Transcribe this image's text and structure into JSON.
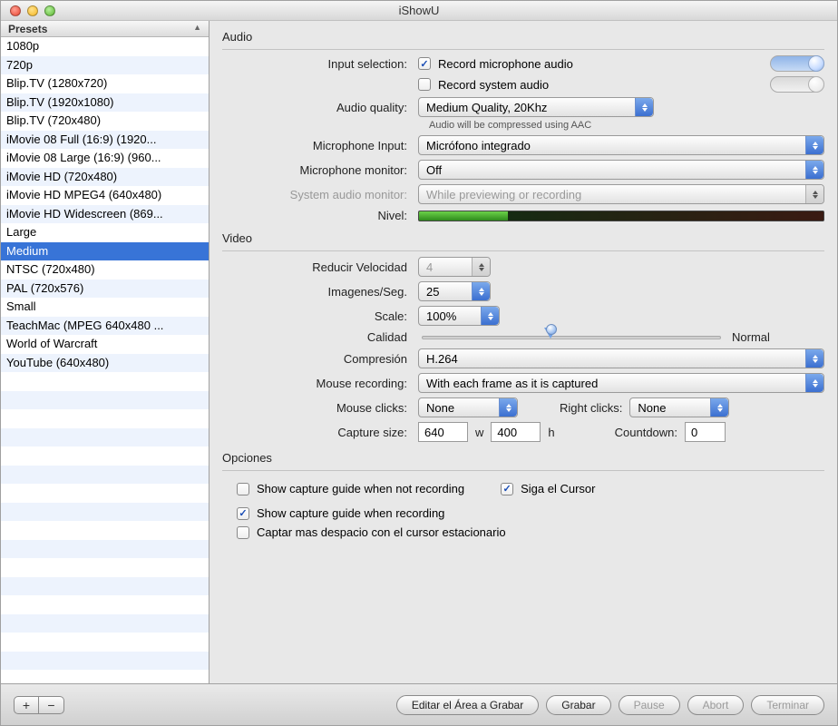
{
  "window": {
    "title": "iShowU"
  },
  "sidebar": {
    "header": "Presets",
    "selected_index": 10,
    "items": [
      "1080p",
      "720p",
      "Blip.TV (1280x720)",
      "Blip.TV (1920x1080)",
      "Blip.TV (720x480)",
      "iMovie 08 Full (16:9) (1920...",
      "iMovie 08 Large (16:9) (960...",
      "iMovie HD (720x480)",
      "iMovie HD MPEG4 (640x480)",
      "iMovie HD Widescreen (869...",
      "Large",
      "Medium",
      "NTSC (720x480)",
      "PAL (720x576)",
      "Small",
      "TeachMac (MPEG 640x480 ...",
      "World of Warcraft",
      "YouTube (640x480)"
    ]
  },
  "audio": {
    "section": "Audio",
    "input_selection_label": "Input selection:",
    "record_mic": "Record microphone audio",
    "record_system": "Record system audio",
    "quality_label": "Audio quality:",
    "quality_value": "Medium Quality, 20Khz",
    "quality_note": "Audio will be compressed using AAC",
    "mic_input_label": "Microphone Input:",
    "mic_input_value": "Micrófono integrado",
    "mic_monitor_label": "Microphone monitor:",
    "mic_monitor_value": "Off",
    "sys_monitor_label": "System audio monitor:",
    "sys_monitor_value": "While previewing or recording",
    "level_label": "Nivel:"
  },
  "video": {
    "section": "Video",
    "reduce_label": "Reducir Velocidad",
    "reduce_value": "4",
    "fps_label": "Imagenes/Seg.",
    "fps_value": "25",
    "scale_label": "Scale:",
    "scale_value": "100%",
    "quality_label": "Calidad",
    "quality_text": "Normal",
    "compress_label": "Compresión",
    "compress_value": "H.264",
    "mouse_rec_label": "Mouse recording:",
    "mouse_rec_value": "With each frame as it is captured",
    "mouse_clicks_label": "Mouse clicks:",
    "mouse_clicks_value": "None",
    "right_clicks_label": "Right clicks:",
    "right_clicks_value": "None",
    "capture_label": "Capture size:",
    "capture_w": "640",
    "capture_wl": "w",
    "capture_h": "400",
    "capture_hl": "h",
    "countdown_label": "Countdown:",
    "countdown_value": "0"
  },
  "options": {
    "section": "Opciones",
    "opt1": "Show capture guide when not recording",
    "opt2": "Siga el Cursor",
    "opt3": "Show capture guide when recording",
    "opt4": "Captar mas despacio con el cursor estacionario"
  },
  "footer": {
    "edit_area": "Editar el Área a Grabar",
    "record": "Grabar",
    "pause": "Pause",
    "abort": "Abort",
    "finish": "Terminar"
  }
}
